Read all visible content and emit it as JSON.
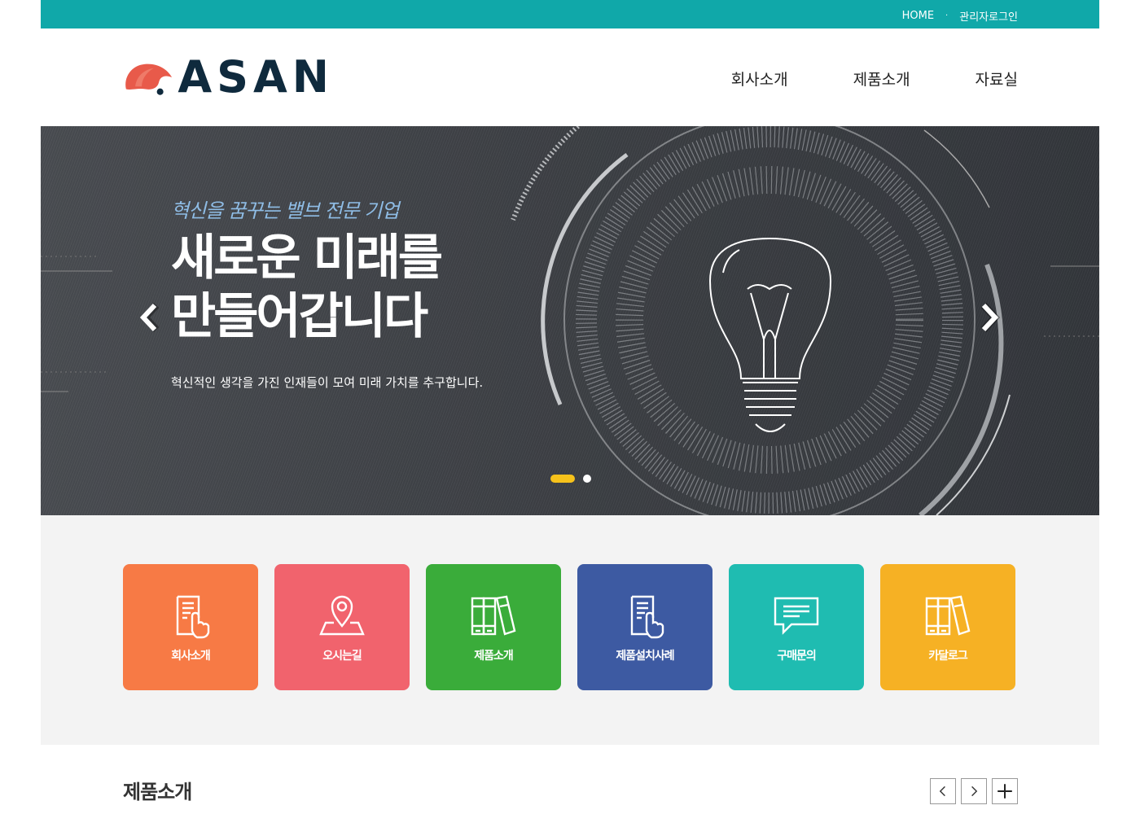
{
  "topbar": {
    "home": "HOME",
    "separator": "·",
    "admin_login": "관리자로그인",
    "color": "#10a8a9"
  },
  "logo": {
    "text": "ASAN",
    "mark_color": "#e85a4a"
  },
  "gnb": [
    {
      "label": "회사소개"
    },
    {
      "label": "제품소개"
    },
    {
      "label": "자료실"
    }
  ],
  "hero": {
    "subtitle": "혁신을 꿈꾸는 밸브 전문 기업",
    "title_line1": "새로운 미래를",
    "title_line2": "만들어갑니다",
    "description": "혁신적인 생각을 가진 인재들이 모여 미래 가치를 추구합니다.",
    "slide_count": 2,
    "active_slide": 1
  },
  "quick_menu": [
    {
      "label": "회사소개",
      "icon": "document-hand-icon",
      "color": "#f77a45"
    },
    {
      "label": "오시는길",
      "icon": "map-pin-icon",
      "color": "#f1636d"
    },
    {
      "label": "제품소개",
      "icon": "books-icon",
      "color": "#3aac3a"
    },
    {
      "label": "제품설치사례",
      "icon": "document-hand-icon",
      "color": "#3d5aa2"
    },
    {
      "label": "구매문의",
      "icon": "speech-bubble-icon",
      "color": "#1fbcb1"
    },
    {
      "label": "카달로그",
      "icon": "books-icon",
      "color": "#f6b124"
    }
  ],
  "products": {
    "title": "제품소개"
  }
}
